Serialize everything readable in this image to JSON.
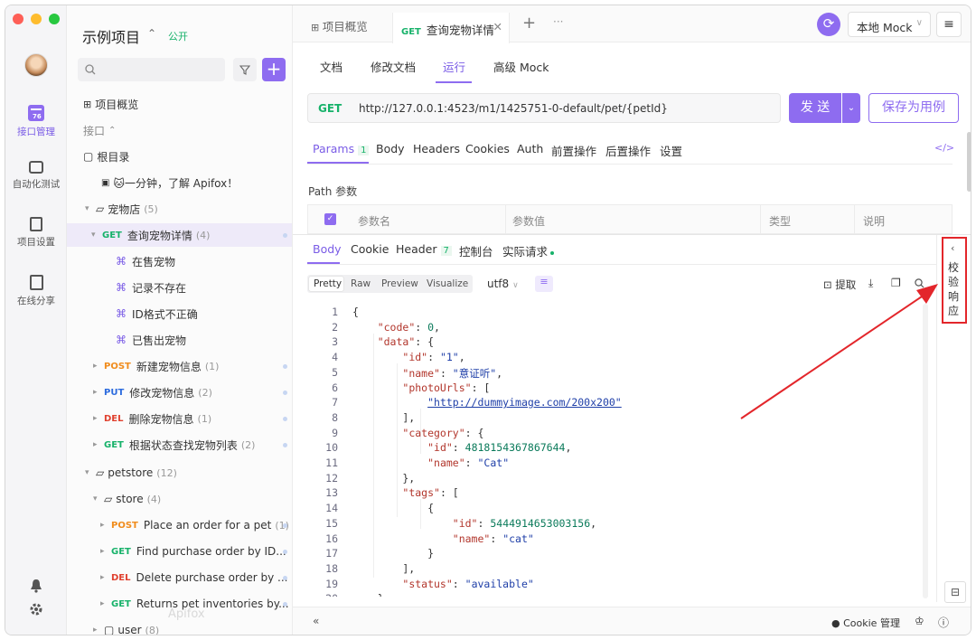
{
  "colors": {
    "accent": "#8e6cf0",
    "get": "#17b26a",
    "post": "#f08c1c",
    "put": "#2c6bde",
    "del": "#e0412f",
    "annotation_red": "#e3262b"
  },
  "rail": {
    "items": [
      {
        "label": "接口管理",
        "icon": "api-icon"
      },
      {
        "label": "自动化测试",
        "icon": "stack-icon"
      },
      {
        "label": "项目设置",
        "icon": "settings-doc-icon"
      },
      {
        "label": "在线分享",
        "icon": "share-icon"
      }
    ]
  },
  "project": {
    "name": "示例项目",
    "visibility": "公开"
  },
  "search": {
    "placeholder": ""
  },
  "tree": {
    "overview": "项目概览",
    "section": "接口",
    "root": "根目录",
    "intro": "🐱一分钟，了解 Apifox！",
    "petstore_cn": {
      "label": "宠物店",
      "count": "(5)"
    },
    "rows": [
      {
        "method": "GET",
        "label": "查询宠物详情",
        "count": "(4)"
      },
      {
        "label": "在售宠物"
      },
      {
        "label": "记录不存在"
      },
      {
        "label": "ID格式不正确"
      },
      {
        "label": "已售出宠物"
      },
      {
        "method": "POST",
        "label": "新建宠物信息",
        "count": "(1)"
      },
      {
        "method": "PUT",
        "label": "修改宠物信息",
        "count": "(2)"
      },
      {
        "method": "DEL",
        "label": "删除宠物信息",
        "count": "(1)"
      },
      {
        "method": "GET",
        "label": "根据状态查找宠物列表",
        "count": "(2)"
      }
    ],
    "petstore": {
      "label": "petstore",
      "count": "(12)"
    },
    "store": {
      "label": "store",
      "count": "(4)"
    },
    "store_rows": [
      {
        "method": "POST",
        "label": "Place an order for a pet",
        "count": "(1)"
      },
      {
        "method": "GET",
        "label": "Find purchase order by ID..."
      },
      {
        "method": "DEL",
        "label": "Delete purchase order by ..."
      },
      {
        "method": "GET",
        "label": "Returns pet inventories by..."
      }
    ],
    "user": {
      "label": "user",
      "count": "(8)"
    },
    "watermark": "Apifox"
  },
  "tabs": {
    "overview": "项目概览",
    "active_method": "GET",
    "active_label": "查询宠物详情",
    "add": "+",
    "more": "···"
  },
  "env": {
    "label": "本地 Mock"
  },
  "subnav": {
    "items": [
      "文档",
      "修改文档",
      "运行",
      "高级 Mock"
    ],
    "active": "运行"
  },
  "request": {
    "method": "GET",
    "url": "http://127.0.0.1:4523/m1/1425751-0-default/pet/{petId}",
    "send": "发 送",
    "save": "保存为用例"
  },
  "reqtabs": {
    "params": "Params",
    "params_count": "1",
    "items": [
      "Body",
      "Headers",
      "Cookies",
      "Auth",
      "前置操作",
      "后置操作",
      "设置"
    ]
  },
  "path_params": {
    "title": "Path 参数",
    "columns": [
      "参数名",
      "参数值",
      "类型",
      "说明"
    ]
  },
  "restabs": {
    "body": "Body",
    "cookie": "Cookie",
    "header": "Header",
    "header_count": "7",
    "console": "控制台",
    "actual": "实际请求"
  },
  "format": {
    "items": [
      "Pretty",
      "Raw",
      "Preview",
      "Visualize"
    ],
    "encoding": "utf8"
  },
  "tools": {
    "extract": "提取"
  },
  "side_panel": {
    "label": "校验响应"
  },
  "footer": {
    "cookie": "Cookie 管理"
  },
  "code_lines": [
    [
      {
        "t": "{",
        "c": ""
      }
    ],
    [
      {
        "t": "    ",
        "c": ""
      },
      {
        "t": "\"code\"",
        "c": "k"
      },
      {
        "t": ": ",
        "c": ""
      },
      {
        "t": "0",
        "c": "n"
      },
      {
        "t": ",",
        "c": ""
      }
    ],
    [
      {
        "t": "    ",
        "c": ""
      },
      {
        "t": "\"data\"",
        "c": "k"
      },
      {
        "t": ": {",
        "c": ""
      }
    ],
    [
      {
        "t": "        ",
        "c": ""
      },
      {
        "t": "\"id\"",
        "c": "k"
      },
      {
        "t": ": ",
        "c": ""
      },
      {
        "t": "\"1\"",
        "c": "s"
      },
      {
        "t": ",",
        "c": ""
      }
    ],
    [
      {
        "t": "        ",
        "c": ""
      },
      {
        "t": "\"name\"",
        "c": "k"
      },
      {
        "t": ": ",
        "c": ""
      },
      {
        "t": "\"意证听\"",
        "c": "s"
      },
      {
        "t": ",",
        "c": ""
      }
    ],
    [
      {
        "t": "        ",
        "c": ""
      },
      {
        "t": "\"photoUrls\"",
        "c": "k"
      },
      {
        "t": ": [",
        "c": ""
      }
    ],
    [
      {
        "t": "            ",
        "c": ""
      },
      {
        "t": "\"http://dummyimage.com/200x200\"",
        "c": "s u"
      }
    ],
    [
      {
        "t": "        ],",
        "c": ""
      }
    ],
    [
      {
        "t": "        ",
        "c": ""
      },
      {
        "t": "\"category\"",
        "c": "k"
      },
      {
        "t": ": {",
        "c": ""
      }
    ],
    [
      {
        "t": "            ",
        "c": ""
      },
      {
        "t": "\"id\"",
        "c": "k"
      },
      {
        "t": ": ",
        "c": ""
      },
      {
        "t": "4818154367867644",
        "c": "n"
      },
      {
        "t": ",",
        "c": ""
      }
    ],
    [
      {
        "t": "            ",
        "c": ""
      },
      {
        "t": "\"name\"",
        "c": "k"
      },
      {
        "t": ": ",
        "c": ""
      },
      {
        "t": "\"Cat\"",
        "c": "s"
      }
    ],
    [
      {
        "t": "        },",
        "c": ""
      }
    ],
    [
      {
        "t": "        ",
        "c": ""
      },
      {
        "t": "\"tags\"",
        "c": "k"
      },
      {
        "t": ": [",
        "c": ""
      }
    ],
    [
      {
        "t": "            {",
        "c": ""
      }
    ],
    [
      {
        "t": "                ",
        "c": ""
      },
      {
        "t": "\"id\"",
        "c": "k"
      },
      {
        "t": ": ",
        "c": ""
      },
      {
        "t": "5444914653003156",
        "c": "n"
      },
      {
        "t": ",",
        "c": ""
      }
    ],
    [
      {
        "t": "                ",
        "c": ""
      },
      {
        "t": "\"name\"",
        "c": "k"
      },
      {
        "t": ": ",
        "c": ""
      },
      {
        "t": "\"cat\"",
        "c": "s"
      }
    ],
    [
      {
        "t": "            }",
        "c": ""
      }
    ],
    [
      {
        "t": "        ],",
        "c": ""
      }
    ],
    [
      {
        "t": "        ",
        "c": ""
      },
      {
        "t": "\"status\"",
        "c": "k"
      },
      {
        "t": ": ",
        "c": ""
      },
      {
        "t": "\"available\"",
        "c": "s"
      }
    ],
    [
      {
        "t": "    }",
        "c": ""
      }
    ]
  ]
}
